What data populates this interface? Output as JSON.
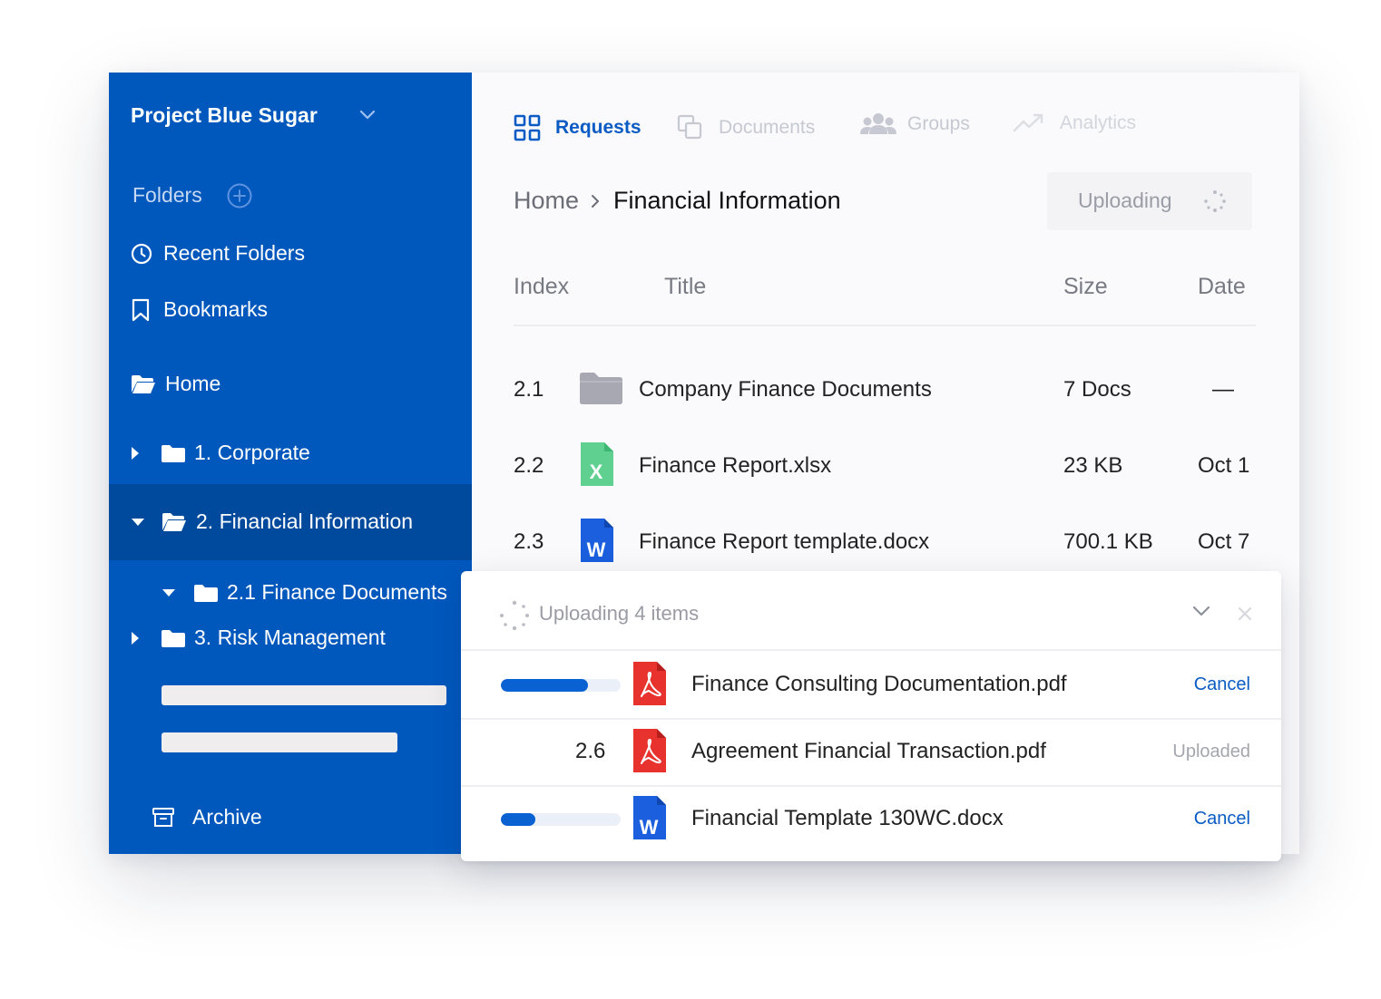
{
  "colors": {
    "sidebar_bg": "#0058bd",
    "sidebar_selected": "#004a9e",
    "accent": "#0a5bc4",
    "progress_fill": "#0a61d1",
    "pdf_red": "#e8322e",
    "excel_green": "#5fd08f",
    "word_blue": "#1b5fde",
    "folder_gray": "#a8a8b2"
  },
  "sidebar": {
    "project_name": "Project Blue Sugar",
    "folders_label": "Folders",
    "recent_folders": "Recent Folders",
    "bookmarks": "Bookmarks",
    "home": "Home",
    "tree": [
      {
        "label": "1. Corporate",
        "expanded": false,
        "icon": "folder-icon"
      },
      {
        "label": "2. Financial Information",
        "expanded": true,
        "selected": true,
        "icon": "folder-open-icon"
      },
      {
        "label": "2.1 Finance Documents",
        "expanded": true,
        "icon": "folder-icon"
      },
      {
        "label": "3. Risk Management",
        "expanded": false,
        "icon": "folder-icon"
      }
    ],
    "archive": "Archive"
  },
  "tabs": [
    {
      "label": "Requests",
      "icon": "grid-icon",
      "active": true
    },
    {
      "label": "Documents",
      "icon": "copy-icon",
      "active": false
    },
    {
      "label": "Groups",
      "icon": "users-icon",
      "active": false
    },
    {
      "label": "Analytics",
      "icon": "trend-icon",
      "active": false
    }
  ],
  "breadcrumb": {
    "home": "Home",
    "current": "Financial Information"
  },
  "upload_status": "Uploading",
  "table": {
    "headers": {
      "index": "Index",
      "title": "Title",
      "size": "Size",
      "date": "Date"
    },
    "rows": [
      {
        "index": "2.1",
        "title": "Company Finance Documents",
        "size": "7 Docs",
        "date": "—",
        "type": "folder"
      },
      {
        "index": "2.2",
        "title": "Finance Report.xlsx",
        "size": "23 KB",
        "date": "Oct 1",
        "type": "excel"
      },
      {
        "index": "2.3",
        "title": "Finance Report template.docx",
        "size": "700.1 KB",
        "date": "Oct 7",
        "type": "word"
      }
    ]
  },
  "upload_panel": {
    "title": "Uploading 4 items",
    "items": [
      {
        "name": "Finance Consulting Documentation.pdf",
        "type": "pdf",
        "progress": 0.73,
        "action": "Cancel"
      },
      {
        "name": "Agreement Financial Transaction.pdf",
        "type": "pdf",
        "index": "2.6",
        "action": "Uploaded"
      },
      {
        "name": "Financial Template 130WC.docx",
        "type": "word",
        "progress": 0.29,
        "action": "Cancel"
      }
    ]
  }
}
